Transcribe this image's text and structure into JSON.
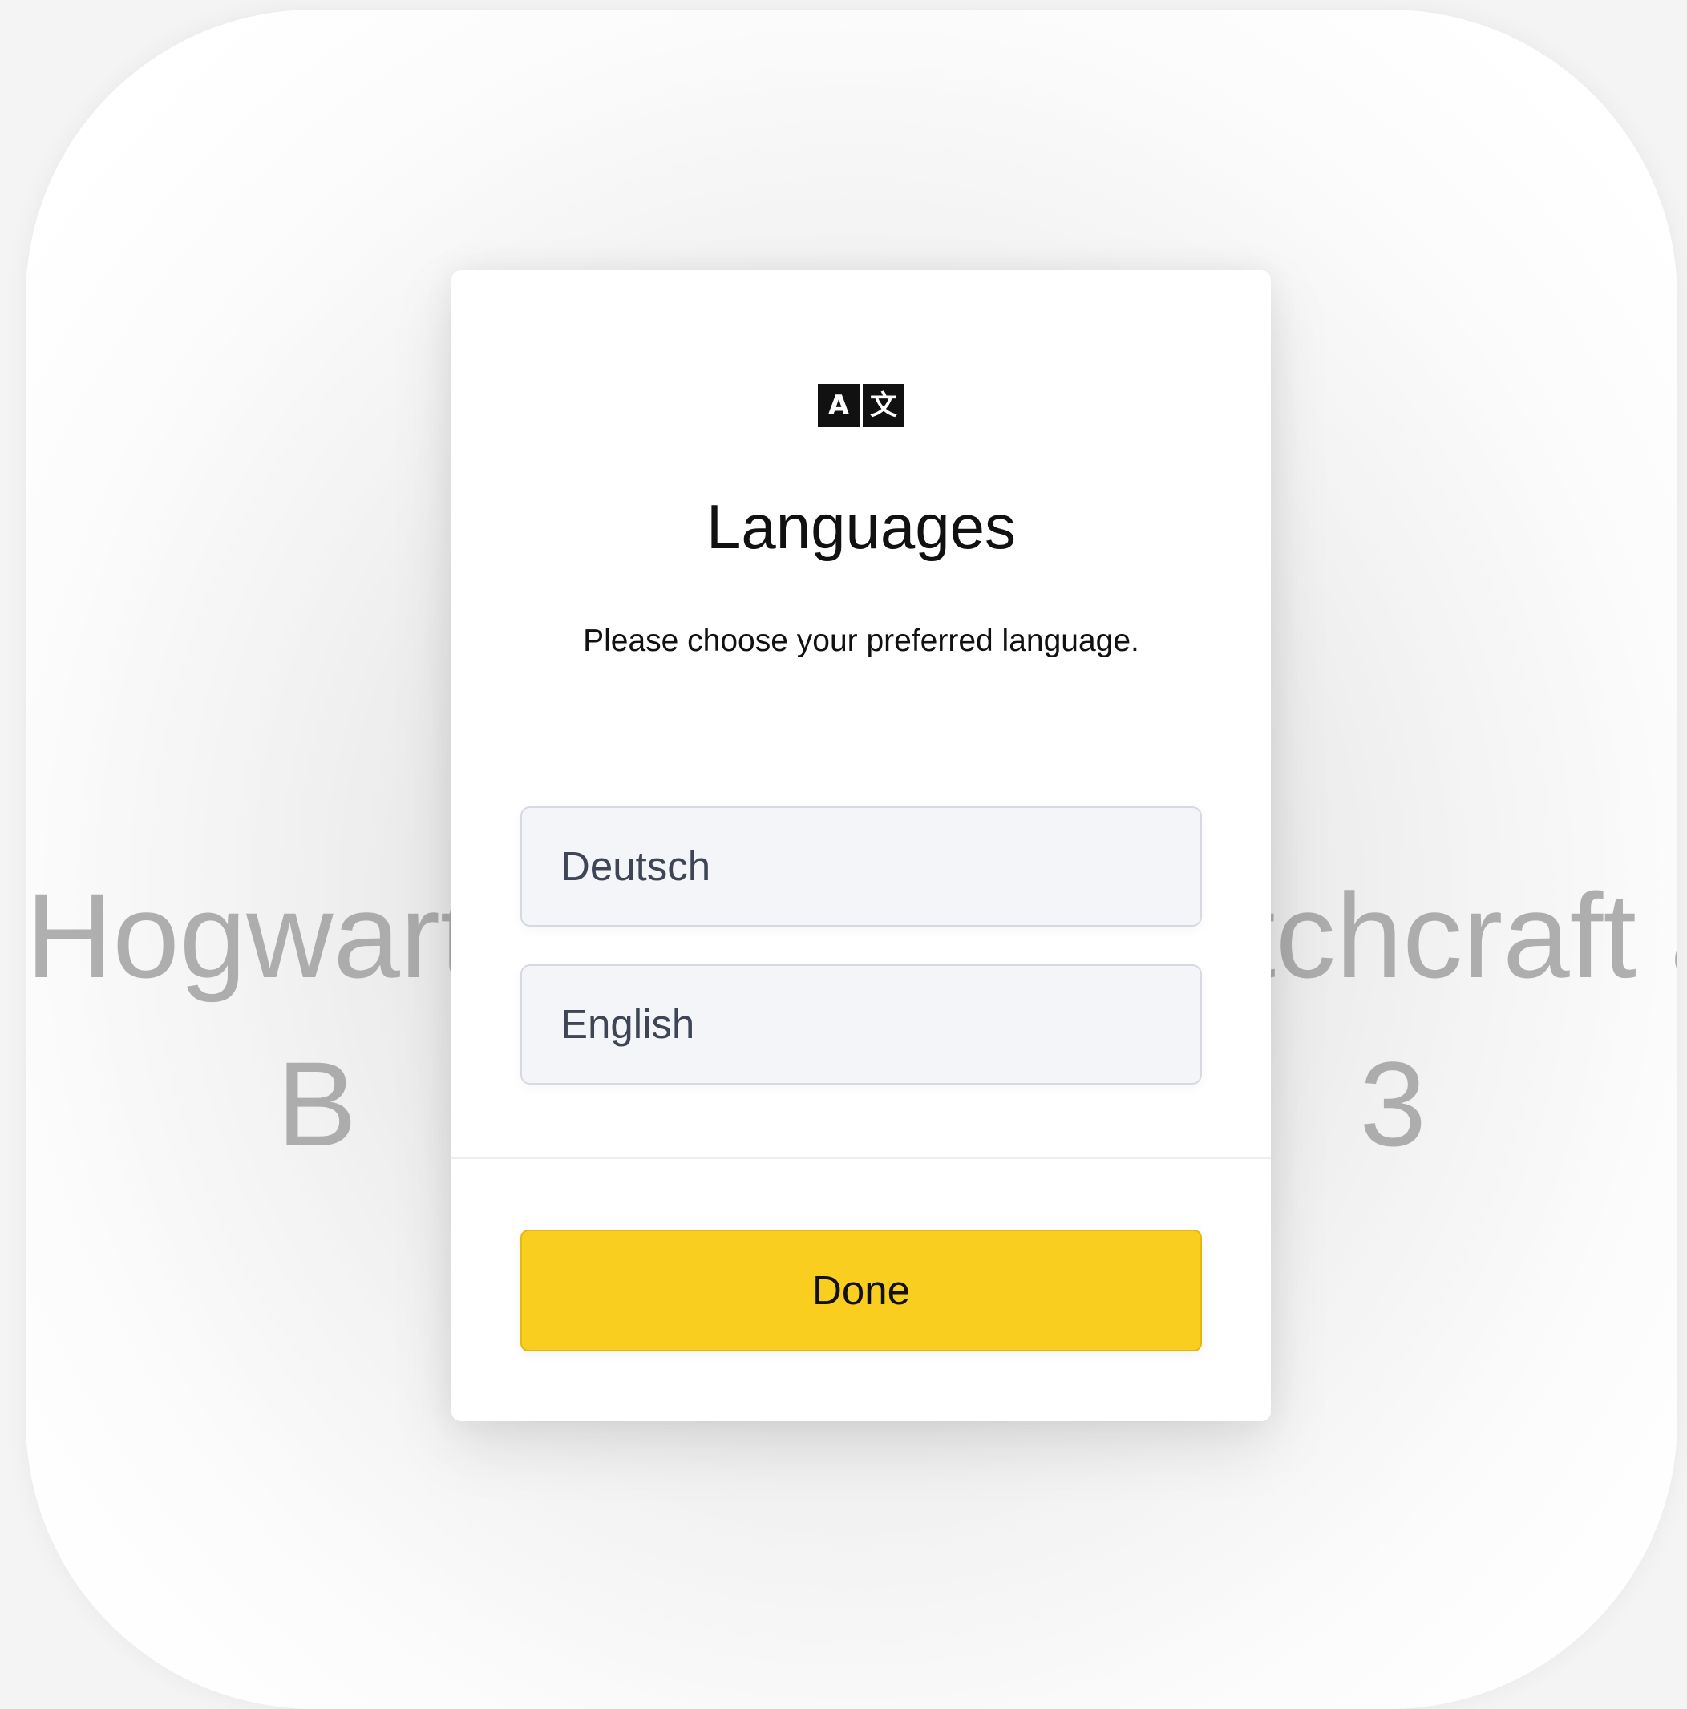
{
  "background": {
    "line1": "Hogwarts School of Witchcraft and Gir",
    "line2": "B                              3"
  },
  "modal": {
    "icon": {
      "name": "translate-icon",
      "left_glyph": "A",
      "right_glyph": "文"
    },
    "title": "Languages",
    "subtitle": "Please choose your preferred language.",
    "options": [
      {
        "label": "Deutsch"
      },
      {
        "label": "English"
      }
    ],
    "done_label": "Done",
    "accent_color": "#f9ce1f"
  }
}
